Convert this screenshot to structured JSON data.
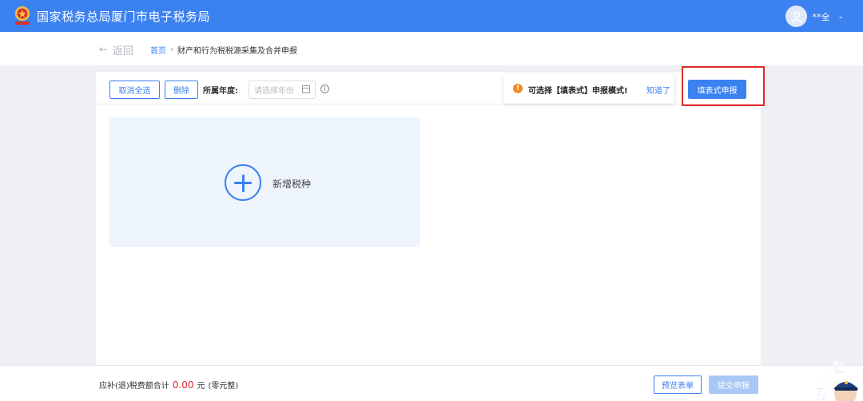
{
  "header": {
    "title": "国家税务总局厦门市电子税务局",
    "user_name": "**全",
    "colors": {
      "bar": "#3b82f0"
    }
  },
  "breadcrumb": {
    "back_label": "返回",
    "home": "首页",
    "current": "财产和行为税税源采集及合并申报"
  },
  "toolbar": {
    "deselect_all": "取消全选",
    "delete": "删除",
    "year_label": "所属年度:",
    "year_placeholder": "请选择年份"
  },
  "add_card": {
    "label": "新增税种"
  },
  "popover": {
    "message": "可选择【填表式】申报模式!",
    "dismiss": "知道了"
  },
  "fill_mode_button": "填表式申报",
  "footer": {
    "total_label": "应补(退)税费额合计",
    "amount": "0.00",
    "unit": "元",
    "amount_words": "(零元整)",
    "preview": "预览表单",
    "submit": "提交申报"
  },
  "mascot": {
    "chars": [
      "征",
      "纳",
      "互"
    ]
  }
}
